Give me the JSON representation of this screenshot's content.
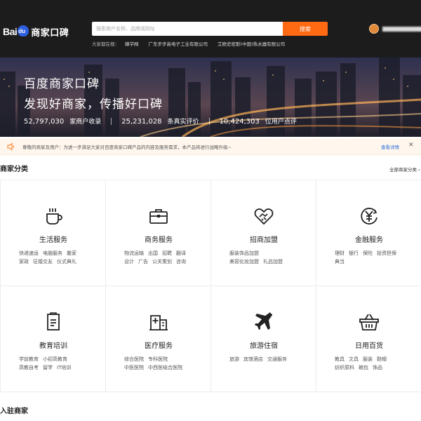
{
  "header": {
    "logo_text": "Bai",
    "logo_name": "商家口碑",
    "search_placeholder": "搜索商户名称、品牌或网址",
    "search_button": "搜索",
    "hot_label": "大家都在搜：",
    "hot_items": [
      "蝉学网",
      "广东步步高电子工业有限公司",
      "艾欧史密斯(中国)热水器有限公司"
    ]
  },
  "banner": {
    "title": "百度商家口碑",
    "subtitle": "发现好商家，传播好口碑",
    "stats": [
      {
        "num": "52,797,030",
        "label": "家商户收录"
      },
      {
        "num": "25,231,028",
        "label": "条真实评价"
      },
      {
        "num": "10,424,303",
        "label": "位用户点评"
      }
    ]
  },
  "notice": {
    "text": "尊敬的商家及用户：为进一步满足大家对百度商家口碑产品的内容及服务需求，本产品将进行战略升级~",
    "detail": "查看详情",
    "close": "✕"
  },
  "categories": {
    "title": "商家分类",
    "all_link": "全部商家分类 ›",
    "items": [
      {
        "name": "生活服务",
        "icon": "coffee-cup-icon",
        "links": [
          "快递速运",
          "电脑服务",
          "搬家",
          "家政",
          "征婚交友",
          "仪式典礼"
        ]
      },
      {
        "name": "商务服务",
        "icon": "briefcase-icon",
        "links": [
          "物流运输",
          "出国",
          "招聘",
          "翻译",
          "设计",
          "广告",
          "公关策划",
          "咨询"
        ]
      },
      {
        "name": "招商加盟",
        "icon": "handshake-icon",
        "links": [
          "服装饰品加盟",
          "美容化妆加盟",
          "礼品加盟"
        ]
      },
      {
        "name": "金融服务",
        "icon": "yen-coin-icon",
        "links": [
          "理财",
          "银行",
          "保险",
          "投资担保",
          "典当"
        ]
      },
      {
        "name": "教育培训",
        "icon": "document-icon",
        "links": [
          "学前教育",
          "小初高教育",
          "高教自考",
          "留学",
          "IT培训"
        ]
      },
      {
        "name": "医疗服务",
        "icon": "hospital-icon",
        "links": [
          "综合医院",
          "专科医院",
          "中医医院",
          "中西医结合医院"
        ]
      },
      {
        "name": "旅游住宿",
        "icon": "airplane-icon",
        "links": [
          "旅游",
          "宾馆酒店",
          "交通服务"
        ]
      },
      {
        "name": "日用百货",
        "icon": "shopping-basket-icon",
        "links": [
          "教具",
          "文具",
          "服装",
          "鞋帽",
          "纺织原料",
          "箱包",
          "饰品"
        ]
      }
    ]
  },
  "section2": {
    "title": "入驻商家"
  },
  "colors": {
    "header_bg": "#1c1c1c",
    "accent": "#ff6a13",
    "link_blue": "#2d6dd8",
    "notice_bg": "#fff7ee"
  }
}
